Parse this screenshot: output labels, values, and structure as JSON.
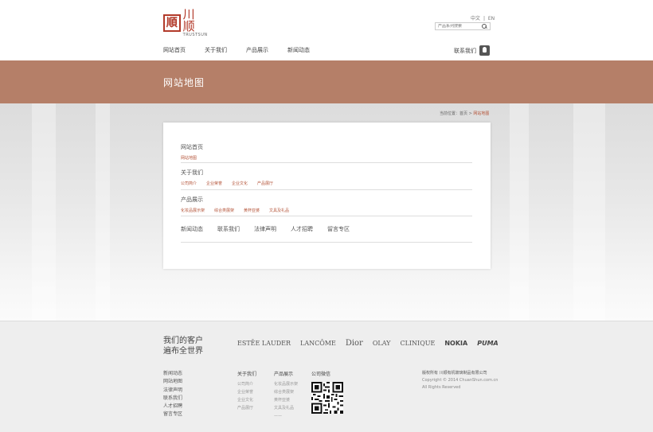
{
  "header": {
    "logo": {
      "mark": "順",
      "name_cn": "川顺",
      "name_en": "TRUSTSUN"
    },
    "lang": {
      "cn": "中文",
      "sep": "|",
      "en": "EN"
    },
    "search": {
      "placeholder": "产品系列搜索"
    },
    "nav": [
      "网站首页",
      "关于我们",
      "产品展示",
      "新闻动态"
    ],
    "contact": "联系我们"
  },
  "banner": {
    "title": "网站地图"
  },
  "breadcrumb": {
    "prefix": "当前位置：",
    "home": "首页",
    "sep": ">",
    "current": "网站地图"
  },
  "sitemap": {
    "home": {
      "title": "网站首页",
      "links": [
        "网站地图"
      ]
    },
    "about": {
      "title": "关于我们",
      "links": [
        "公司简介",
        "企业荣誉",
        "企业文化",
        "产品展厅"
      ]
    },
    "products": {
      "title": "产品展示",
      "links": [
        "化妆品展示架",
        "综合类展架",
        "黄杯亚婆",
        "文具及礼品"
      ]
    },
    "others": [
      "新闻动态",
      "联系我们",
      "法律声明",
      "人才招聘",
      "留言专区"
    ]
  },
  "footer": {
    "slogan": [
      "我们的客户",
      "遍布全世界"
    ],
    "brands": [
      "ESTĒE LAUDER",
      "LANCÔME",
      "Dior",
      "OLAY",
      "CLINIQUE",
      "NOKIA",
      "PUMA"
    ],
    "main_links": [
      "新闻动态",
      "网站地图",
      "法律声明",
      "联系我们",
      "人才招聘",
      "留言专区"
    ],
    "about": {
      "title": "关于我们",
      "items": [
        "公司简介",
        "企业荣誉",
        "企业文化",
        "产品展厅"
      ]
    },
    "products": {
      "title": "产品展示",
      "items": [
        "化妆品展示架",
        "综合类展架",
        "黄杯亚婆",
        "文具及礼品",
        "——"
      ]
    },
    "wechat": {
      "title": "公司微信"
    },
    "copyright": [
      "版权所有  川顺有机玻璃制品有限公司",
      "Copyright © 2014 ChuanShun.com.cn",
      "All Rights Reserved"
    ]
  },
  "colors": {
    "banner": "#b57f68",
    "accent": "#b5553a",
    "footer_bg": "#eeeeee"
  }
}
